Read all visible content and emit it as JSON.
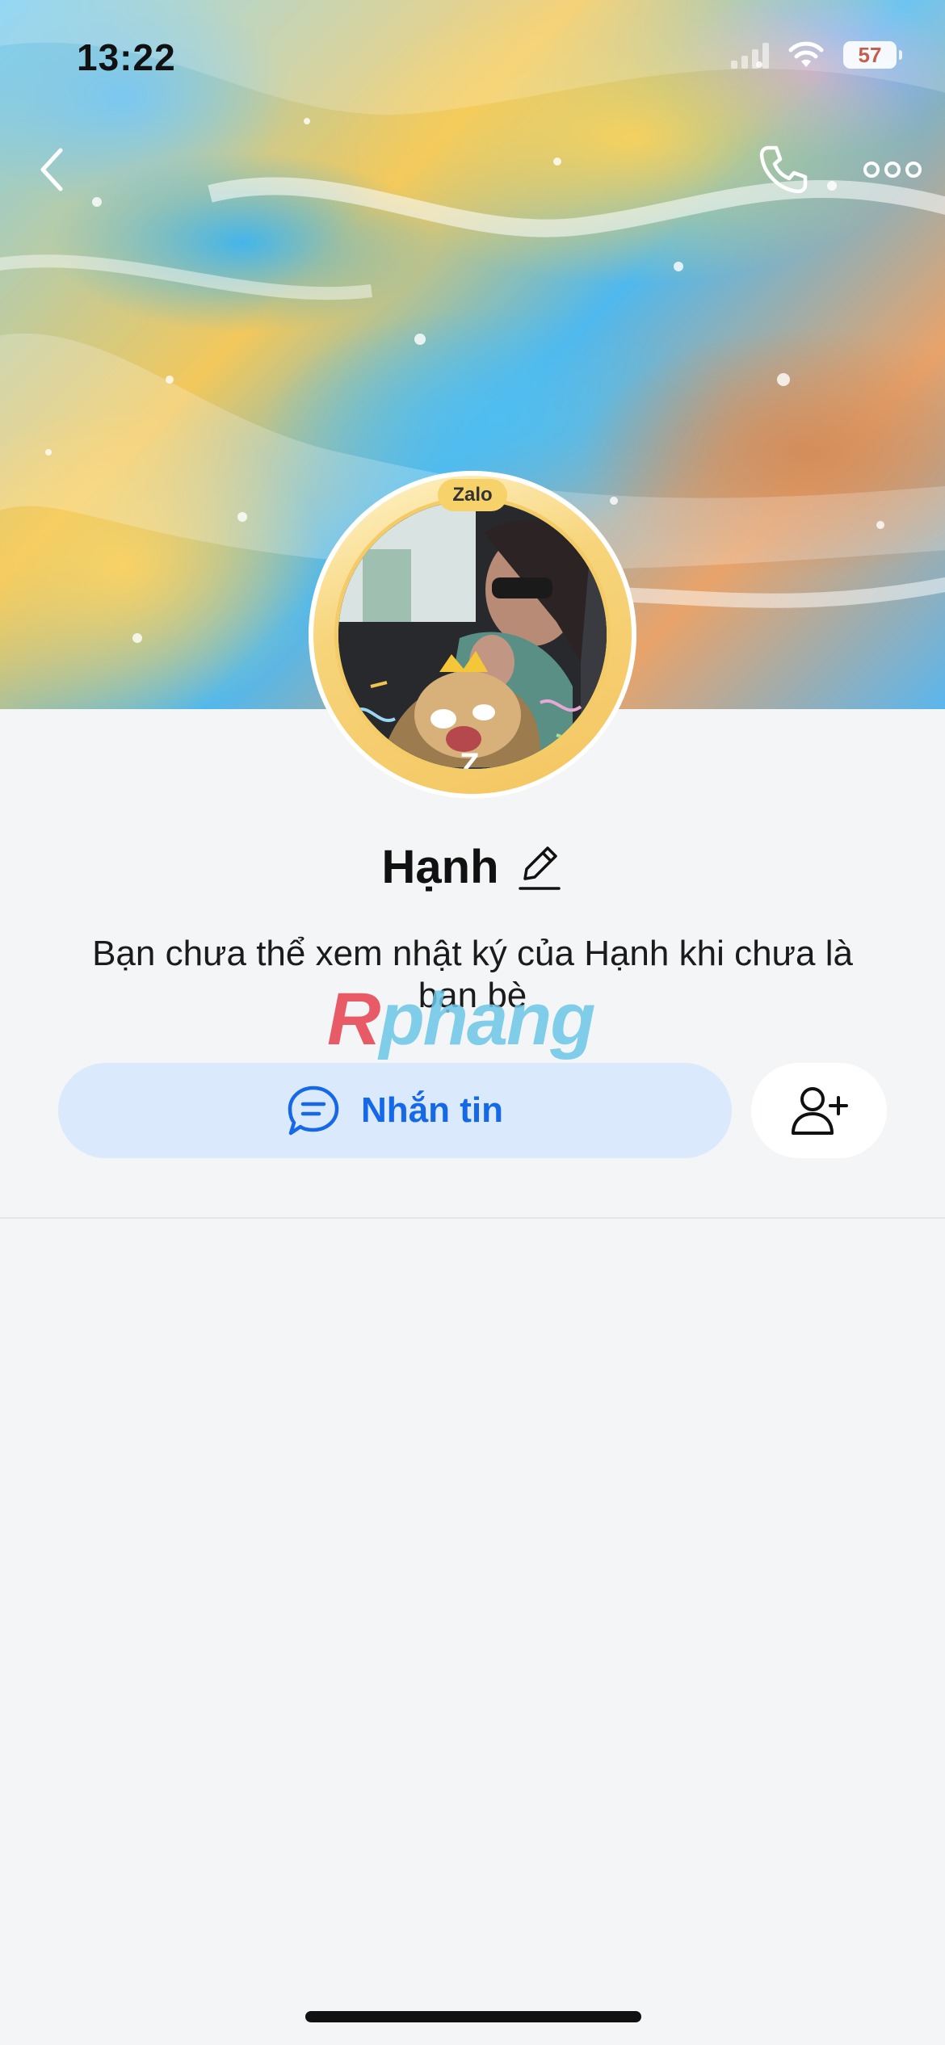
{
  "status_bar": {
    "time": "13:22",
    "battery": "57"
  },
  "nav": {
    "back_icon": "chevron-left-icon",
    "call_icon": "phone-icon",
    "more_icon": "more-dots-icon"
  },
  "avatar": {
    "badge": "Zalo"
  },
  "profile": {
    "name": "Hạnh",
    "edit_icon": "pencil-icon",
    "notice": "Bạn chưa thể xem nhật ký của Hạnh khi chưa là bạn bè"
  },
  "watermark": {
    "part1": "R",
    "part2": "phang"
  },
  "actions": {
    "message_label": "Nhắn tin",
    "message_icon": "chat-bubble-icon",
    "add_friend_icon": "add-friend-icon"
  },
  "colors": {
    "accent": "#1569e8",
    "message_bg": "#dbe9fd",
    "page_bg": "#f4f5f7"
  }
}
